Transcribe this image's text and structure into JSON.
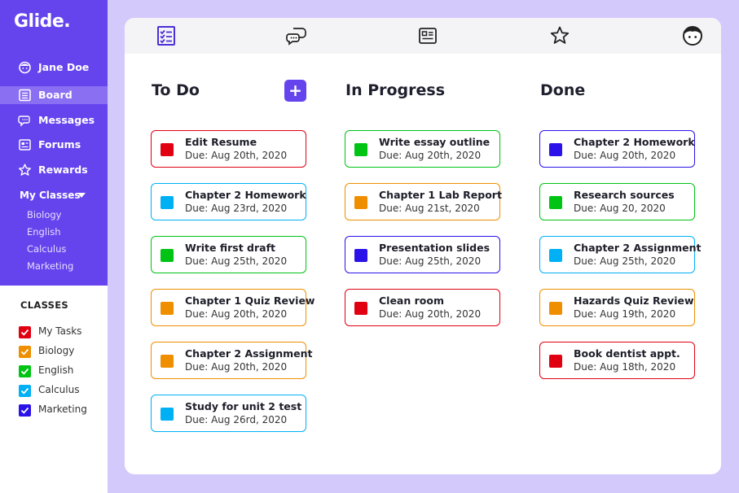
{
  "app": {
    "logo": "Glide."
  },
  "user": {
    "name": "Jane Doe"
  },
  "nav": [
    {
      "label": "Board",
      "icon": "board-icon",
      "active": true
    },
    {
      "label": "Messages",
      "icon": "messages-icon"
    },
    {
      "label": "Forums",
      "icon": "forums-icon"
    },
    {
      "label": "Rewards",
      "icon": "star-icon"
    }
  ],
  "my_classes": {
    "label": "My Classes",
    "items": [
      "Biology",
      "English",
      "Calculus",
      "Marketing"
    ]
  },
  "classes_filter": {
    "title": "CLASSES",
    "items": [
      {
        "label": "My Tasks",
        "color": "#e00012"
      },
      {
        "label": "Biology",
        "color": "#ef8f00"
      },
      {
        "label": "English",
        "color": "#00c414"
      },
      {
        "label": "Calculus",
        "color": "#00b0f5"
      },
      {
        "label": "Marketing",
        "color": "#2a12e8"
      }
    ]
  },
  "topbar_icons": [
    "tasks-icon",
    "messages-icon",
    "forums-icon",
    "star-icon",
    "avatar-icon"
  ],
  "colors": {
    "accent": "#6544ee",
    "red": "#e00012",
    "orange": "#ef8f00",
    "green": "#00c414",
    "cyan": "#00b0f5",
    "blue": "#2a12e8"
  },
  "columns": [
    {
      "title": "To Do",
      "add_label": "+",
      "tasks": [
        {
          "title": "Edit Resume",
          "due": "Due: Aug 20th, 2020",
          "color": "#e00012"
        },
        {
          "title": "Chapter 2 Homework",
          "due": "Due: Aug 23rd, 2020",
          "color": "#00b0f5"
        },
        {
          "title": "Write first draft",
          "due": "Due: Aug 25th, 2020",
          "color": "#00c414"
        },
        {
          "title": "Chapter 1 Quiz Review",
          "due": "Due: Aug 20th, 2020",
          "color": "#ef8f00"
        },
        {
          "title": "Chapter 2 Assignment",
          "due": "Due: Aug 20th, 2020",
          "color": "#ef8f00"
        },
        {
          "title": "Study for unit 2 test",
          "due": "Due: Aug 26rd, 2020",
          "color": "#00b0f5"
        }
      ]
    },
    {
      "title": "In Progress",
      "tasks": [
        {
          "title": "Write essay outline",
          "due": "Due: Aug 20th, 2020",
          "color": "#00c414"
        },
        {
          "title": "Chapter 1 Lab Report",
          "due": "Due: Aug 21st, 2020",
          "color": "#ef8f00"
        },
        {
          "title": "Presentation slides",
          "due": "Due: Aug 25th, 2020",
          "color": "#2a12e8"
        },
        {
          "title": "Clean room",
          "due": "Due: Aug 20th, 2020",
          "color": "#e00012"
        }
      ]
    },
    {
      "title": "Done",
      "tasks": [
        {
          "title": "Chapter 2 Homework",
          "due": "Due: Aug 20th, 2020",
          "color": "#2a12e8"
        },
        {
          "title": "Research sources",
          "due": "Due: Aug 20, 2020",
          "color": "#00c414"
        },
        {
          "title": "Chapter 2 Assignment",
          "due": "Due: Aug 25th, 2020",
          "color": "#00b0f5"
        },
        {
          "title": "Hazards Quiz Review",
          "due": "Due: Aug 19th, 2020",
          "color": "#ef8f00"
        },
        {
          "title": "Book dentist appt.",
          "due": "Due: Aug 18th, 2020",
          "color": "#e00012"
        }
      ]
    }
  ]
}
